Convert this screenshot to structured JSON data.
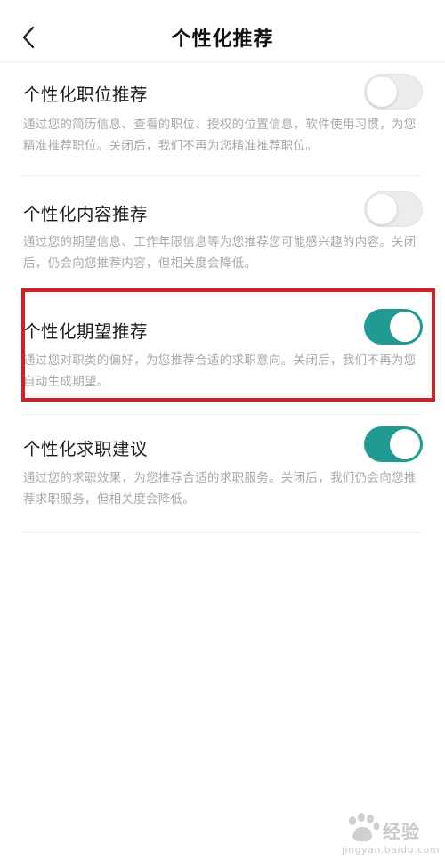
{
  "header": {
    "title": "个性化推荐",
    "back_icon": "chevron-left-icon"
  },
  "settings": [
    {
      "title": "个性化职位推荐",
      "description": "通过您的简历信息、查看的职位、授权的位置信息，软件使用习惯，为您精准推荐职位。关闭后，我们不再为您精准推荐职位。",
      "enabled": false
    },
    {
      "title": "个性化内容推荐",
      "description": "通过您的期望信息、工作年限信息等为您推荐您可能感兴趣的内容。关闭后，仍会向您推荐内容，但相关度会降低。",
      "enabled": false
    },
    {
      "title": "个性化期望推荐",
      "description": "通过您对职类的偏好，为您推荐合适的求职意向。关闭后，我们不再为您自动生成期望。",
      "enabled": true
    },
    {
      "title": "个性化求职建议",
      "description": "通过您的求职效果，为您推荐合适的求职服务。关闭后，我们仍会向您推荐求职服务，但相关度会降低。",
      "enabled": true
    }
  ],
  "colors": {
    "toggle_on": "#1f9b93",
    "toggle_off": "#ececec",
    "highlight_border": "#d2202a"
  },
  "watermark": {
    "text": "经验",
    "url": "jingyan.baidu.com"
  }
}
